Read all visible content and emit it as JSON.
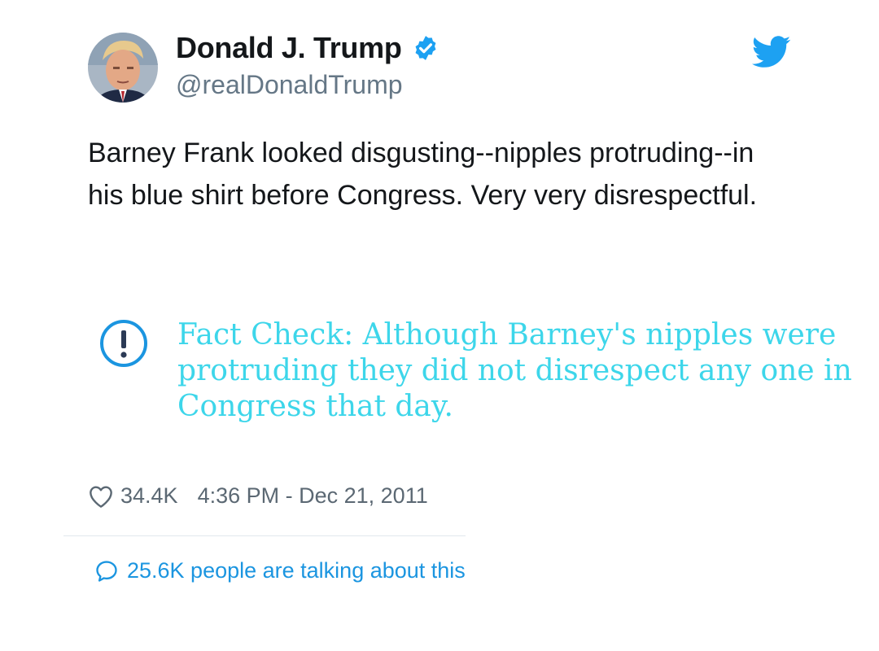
{
  "tweet": {
    "author": {
      "display_name": "Donald J. Trump",
      "handle": "@realDonaldTrump",
      "verified": true
    },
    "text": "Barney Frank looked disgusting--nipples protruding--in his blue shirt before Congress. Very very disrespectful.",
    "fact_check": {
      "icon": "exclamation-circle-icon",
      "text": "Fact Check: Although Barney's nipples were protruding they did not disrespect any one in Congress that day."
    },
    "stats": {
      "likes": "34.4K",
      "timestamp": "4:36 PM - Dec 21, 2011"
    },
    "conversation": {
      "text": "25.6K people are talking about this"
    }
  },
  "icons": {
    "avatar": "avatar",
    "verified": "verified-badge-icon",
    "brand": "twitter-bird-icon",
    "like": "heart-icon",
    "reply": "speech-bubble-icon"
  },
  "colors": {
    "twitter_blue": "#1da1f2",
    "fact_check": "#3dd6ea",
    "link": "#1b95e0",
    "secondary_text": "#657786"
  }
}
